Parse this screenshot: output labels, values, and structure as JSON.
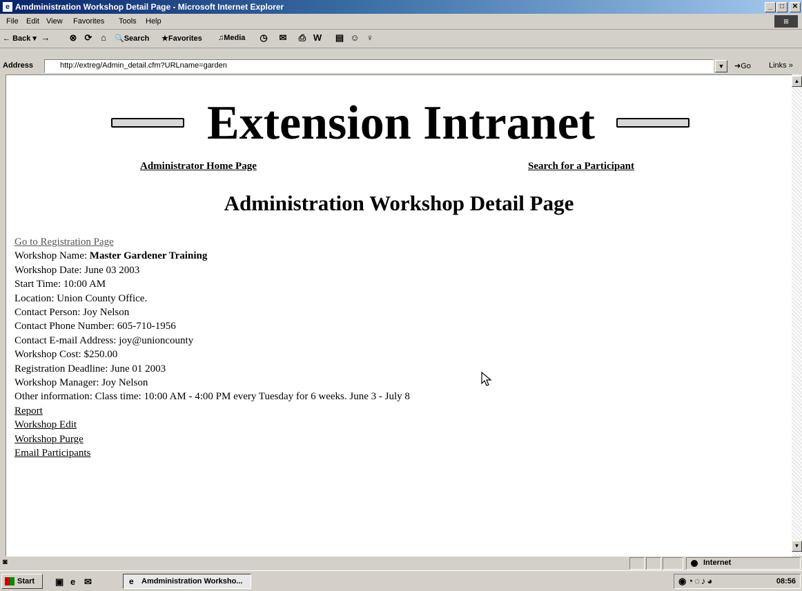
{
  "window": {
    "title": "Amdministration Workshop Detail Page - Microsoft Internet Explorer",
    "controls": {
      "minimize": "_",
      "maximize": "□",
      "close": "✕"
    }
  },
  "menu": [
    "File",
    "Edit",
    "View",
    "Favorites",
    "Tools",
    "Help"
  ],
  "toolbar": {
    "back": "Back",
    "search": "Search",
    "favorites": "Favorites",
    "media": "Media"
  },
  "address": {
    "label": "Address",
    "url": "http://extreg/Admin_detail.cfm?URLname=garden",
    "go": "Go",
    "links": "Links"
  },
  "page": {
    "banner": "Extension Intranet",
    "admin_home_link": "Administrator Home Page",
    "search_link": "Search for a Participant",
    "heading": "Administration Workshop Detail Page",
    "registration_link": "Go to Registration Page",
    "fields": {
      "workshop_name_label": "Workshop Name: ",
      "workshop_name_value": "Master Gardener Training",
      "workshop_date": "Workshop Date: June 03 2003",
      "start_time": "Start Time: 10:00 AM",
      "location": "Location: Union County Office.",
      "contact_person": "Contact Person: Joy Nelson",
      "contact_phone": "Contact Phone Number: 605-710-1956",
      "contact_email": "Contact E-mail Address: joy@unioncounty",
      "workshop_cost": "Workshop Cost: $250.00",
      "registration_deadline": "Registration Deadline: June 01 2003",
      "workshop_manager": "Workshop Manager: Joy Nelson",
      "other_information": "Other information: Class time: 10:00 AM - 4:00 PM every Tuesday for 6 weeks. June 3 - July 8"
    },
    "actions": {
      "report": "Report",
      "workshop_edit": "Workshop Edit",
      "workshop_purge": "Workshop Purge",
      "email_participants": "Email Participants"
    }
  },
  "status": {
    "zone": "Internet"
  },
  "taskbar": {
    "start": "Start",
    "task": "Amdministration Worksho...",
    "clock": "08:56"
  }
}
